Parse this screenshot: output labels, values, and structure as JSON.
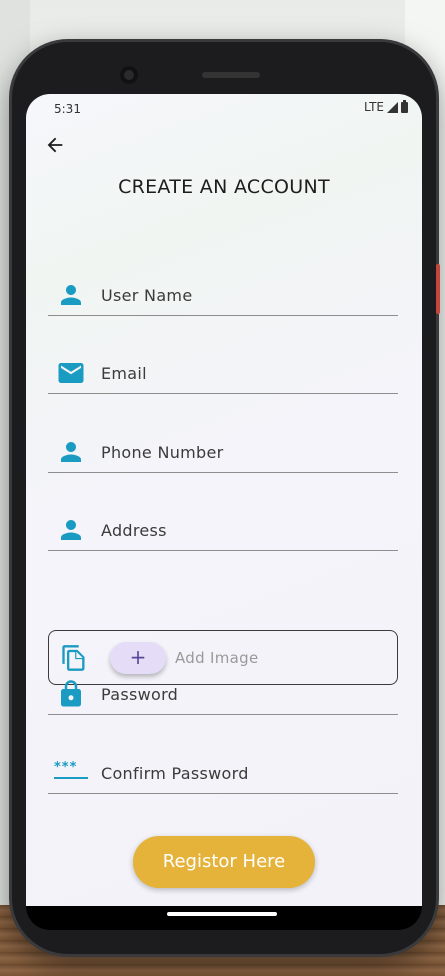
{
  "status_bar": {
    "time": "5:31",
    "network": "LTE"
  },
  "header": {
    "title": "CREATE AN ACCOUNT"
  },
  "form": {
    "fields": [
      {
        "label": "User Name",
        "icon": "person-icon"
      },
      {
        "label": "Email",
        "icon": "email-icon"
      },
      {
        "label": "Phone Number",
        "icon": "person-icon"
      },
      {
        "label": "Address",
        "icon": "person-icon"
      },
      {
        "label": "Password",
        "icon": "lock-icon"
      },
      {
        "label": "Confirm Password",
        "icon": "password-stars-icon"
      }
    ],
    "image_picker": {
      "label": "Add Image",
      "button": "+",
      "icon": "copy-icon"
    },
    "password_stars": "***"
  },
  "actions": {
    "register_label": "Registor Here"
  },
  "colors": {
    "accent": "#1a9bc2",
    "button": "#e5b23a",
    "plus_bg": "#e5dcf8"
  }
}
